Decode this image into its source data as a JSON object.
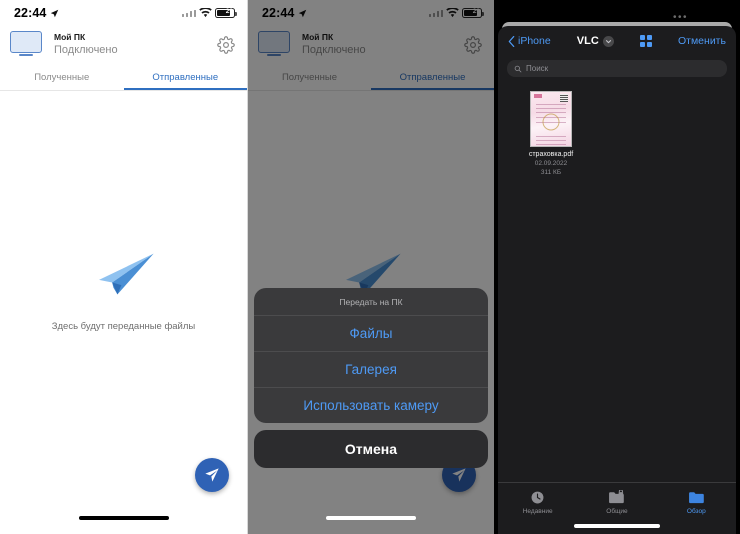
{
  "panel1": {
    "status_bar": {
      "time": "22:44",
      "location_icon": "location-arrow-icon",
      "wifi_icon": "wifi-icon",
      "battery_icon": "battery-icon",
      "battery_level": "29"
    },
    "device": {
      "icon": "monitor-icon",
      "name": "Мой ПК",
      "status": "Подключено",
      "settings_icon": "gear-icon"
    },
    "tabs": [
      {
        "label": "Полученные",
        "active": false
      },
      {
        "label": "Отправленные",
        "active": true
      }
    ],
    "empty_state": {
      "icon": "paper-plane-icon",
      "text": "Здесь будут переданные файлы"
    },
    "fab": {
      "icon": "send-plane-icon",
      "color": "#2f62b5"
    }
  },
  "panel2": {
    "status_bar": {
      "time": "22:44",
      "location_icon": "location-arrow-icon",
      "wifi_icon": "wifi-icon",
      "battery_icon": "battery-icon",
      "battery_level": "29"
    },
    "device": {
      "icon": "monitor-icon",
      "name": "Мой ПК",
      "status": "Подключено",
      "settings_icon": "gear-icon"
    },
    "tabs": [
      {
        "label": "Полученные",
        "active": false
      },
      {
        "label": "Отправленные",
        "active": true
      }
    ],
    "empty_state": {
      "icon": "paper-plane-icon",
      "text": "Здесь будут переданные файлы"
    },
    "action_sheet": {
      "title": "Передать на ПК",
      "options": [
        {
          "label": "Файлы"
        },
        {
          "label": "Галерея"
        },
        {
          "label": "Использовать камеру"
        }
      ],
      "cancel_label": "Отмена",
      "accent_color": "#4e9af5"
    }
  },
  "panel3": {
    "nav": {
      "back_label": "iPhone",
      "back_icon": "chevron-left-icon",
      "title": "VLC",
      "title_chevron_icon": "chevron-down-icon",
      "grid_icon": "grid-view-icon",
      "cancel_label": "Отменить"
    },
    "search": {
      "placeholder": "Поиск",
      "icon": "search-icon",
      "value": ""
    },
    "files": [
      {
        "icon": "pdf-document-thumbnail",
        "name": "страховка.pdf",
        "date": "02.09.2022",
        "size": "311 КБ"
      }
    ],
    "tab_bar": [
      {
        "label": "Недавние",
        "icon": "clock-icon",
        "active": false
      },
      {
        "label": "Общие",
        "icon": "shared-folder-icon",
        "active": false
      },
      {
        "label": "Обзор",
        "icon": "folder-icon",
        "active": true
      }
    ],
    "accent_color": "#4e9af5"
  }
}
